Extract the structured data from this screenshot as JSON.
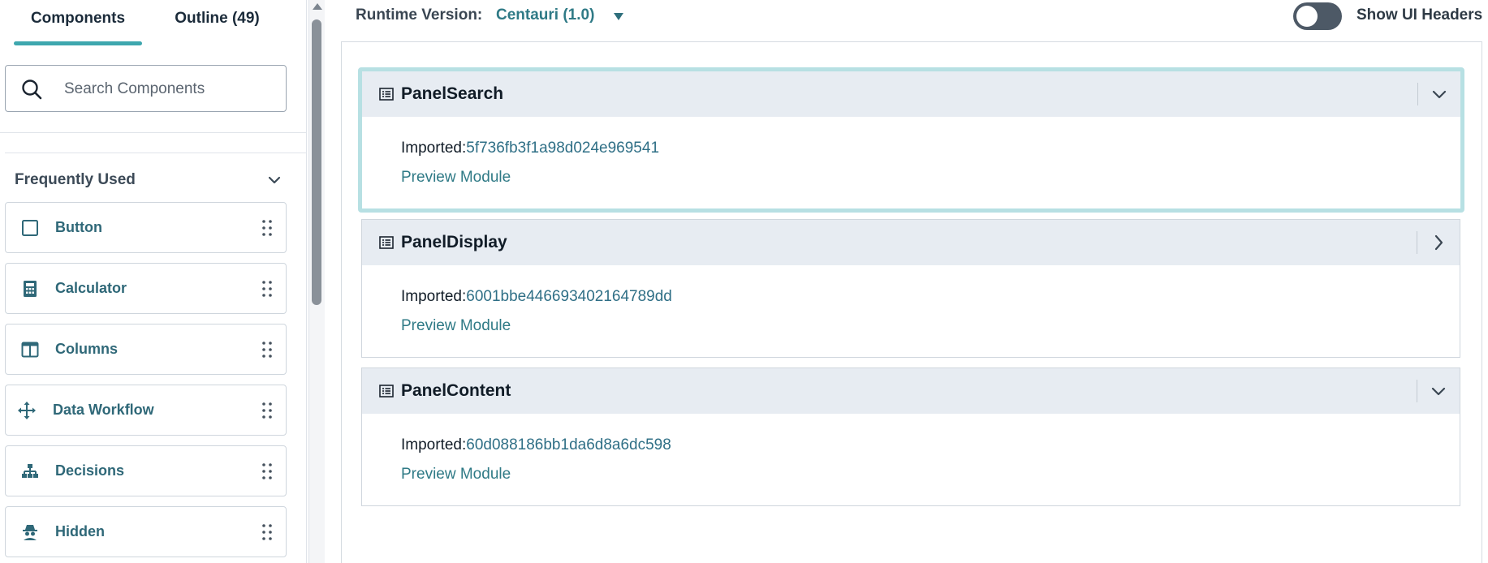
{
  "sidebar": {
    "tabs": [
      {
        "label": "Components",
        "active": true
      },
      {
        "label": "Outline (49)",
        "active": false
      }
    ],
    "search": {
      "placeholder": "Search Components",
      "value": ""
    },
    "section": {
      "label": "Frequently Used"
    },
    "items": [
      {
        "label": "Button",
        "icon": "square-icon"
      },
      {
        "label": "Calculator",
        "icon": "calculator-icon"
      },
      {
        "label": "Columns",
        "icon": "columns-icon"
      },
      {
        "label": "Data Workflow",
        "icon": "move-arrows-icon"
      },
      {
        "label": "Decisions",
        "icon": "hierarchy-icon"
      },
      {
        "label": "Hidden",
        "icon": "spy-icon"
      }
    ]
  },
  "topbar": {
    "runtime_label": "Runtime Version:",
    "runtime_value": "Centauri (1.0)",
    "toggle_label": "Show UI Headers",
    "toggle_on": false
  },
  "panels": [
    {
      "title": "PanelSearch",
      "imported_label": "Imported:",
      "hash": "5f736fb3f1a98d024e969541",
      "preview": "Preview Module",
      "expanded": true,
      "selected": true
    },
    {
      "title": "PanelDisplay",
      "imported_label": "Imported:",
      "hash": "6001bbe446693402164789dd",
      "preview": "Preview Module",
      "expanded": false,
      "selected": false
    },
    {
      "title": "PanelContent",
      "imported_label": "Imported:",
      "hash": "60d088186bb1da6d8a6dc598",
      "preview": "Preview Module",
      "expanded": true,
      "selected": false
    }
  ],
  "colors": {
    "accent": "#3ea7ae",
    "link": "#2f7a86",
    "panel_header": "#e7ecf2",
    "selected_border": "#b7e0e3",
    "toggle_off": "#4d5966"
  }
}
